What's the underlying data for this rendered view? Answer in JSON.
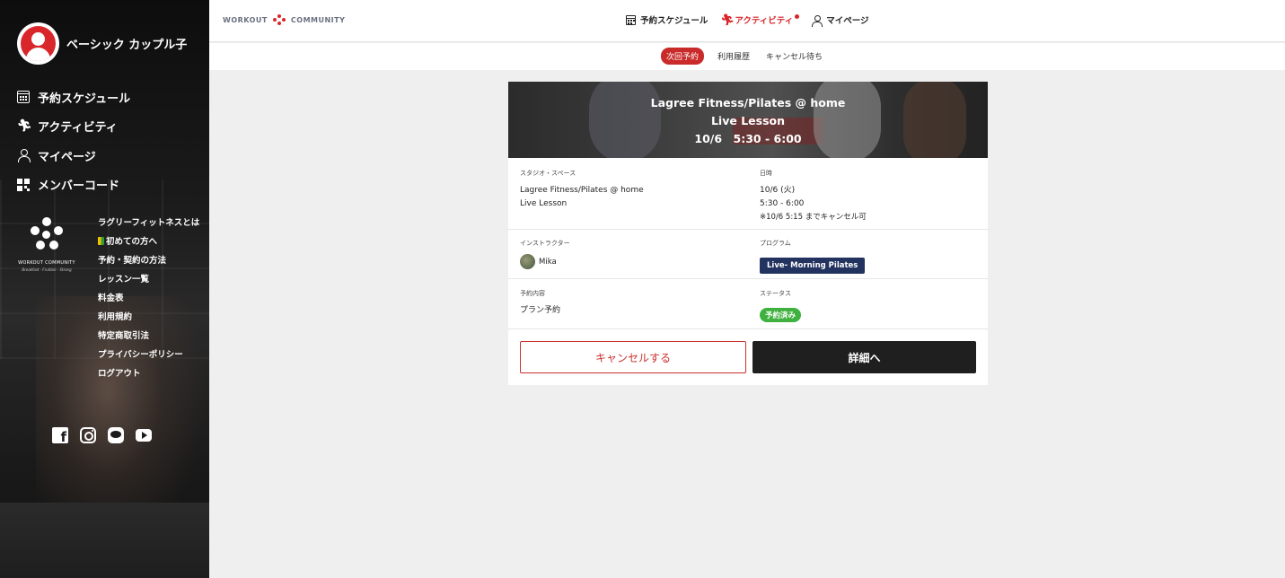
{
  "profile": {
    "name": "ベーシック カップル子"
  },
  "sidebar": {
    "nav": [
      {
        "label": "予約スケジュール",
        "icon": "calendar-icon"
      },
      {
        "label": "アクティビティ",
        "icon": "running-icon"
      },
      {
        "label": "マイページ",
        "icon": "user-icon"
      },
      {
        "label": "メンバーコード",
        "icon": "qr-code-icon"
      }
    ],
    "logo": {
      "text": "WORKOUT COMMUNITY",
      "sub": "Breakfast · Fruition · Strong"
    },
    "links": [
      {
        "label": "ラグリーフィットネスとは"
      },
      {
        "label": "初めての方へ"
      },
      {
        "label": "予約・契約の方法"
      },
      {
        "label": "レッスン一覧"
      },
      {
        "label": "料金表"
      },
      {
        "label": "利用規約"
      },
      {
        "label": "特定商取引法"
      },
      {
        "label": "プライバシーポリシー"
      },
      {
        "label": "ログアウト"
      }
    ],
    "social": [
      "facebook-icon",
      "instagram-icon",
      "line-icon",
      "youtube-icon"
    ]
  },
  "header": {
    "brand_left": "WORKOUT",
    "brand_right": "COMMUNITY",
    "nav": [
      {
        "label": "予約スケジュール"
      },
      {
        "label": "アクティビティ"
      },
      {
        "label": "マイページ"
      }
    ]
  },
  "subtabs": [
    {
      "label": "次回予約"
    },
    {
      "label": "利用履歴"
    },
    {
      "label": "キャンセル待ち"
    }
  ],
  "card": {
    "hero": {
      "line1": "Lagree Fitness/Pilates @ home",
      "line2": "Live Lesson",
      "line3": "10/6　5:30 - 6:00"
    },
    "studio": {
      "label": "スタジオ・スペース",
      "line1": "Lagree Fitness/Pilates @ home",
      "line2": "Live Lesson"
    },
    "datetime": {
      "label": "日時",
      "date": "10/6 (火)",
      "time": "5:30 - 6:00",
      "note": "※10/6 5:15 までキャンセル可"
    },
    "instructor": {
      "label": "インストラクター",
      "name": "Mika"
    },
    "program": {
      "label": "プログラム",
      "name": "Live- Morning Pilates"
    },
    "reservation": {
      "label": "予約内容",
      "value": "プラン予約"
    },
    "status": {
      "label": "ステータス",
      "value": "予約済み"
    },
    "buttons": {
      "cancel": "キャンセルする",
      "detail": "詳細へ"
    }
  },
  "colors": {
    "accent": "#d8262a",
    "program_badge": "#23335f",
    "status_badge": "#3fb13f",
    "detail_button": "#1f1f1f"
  }
}
